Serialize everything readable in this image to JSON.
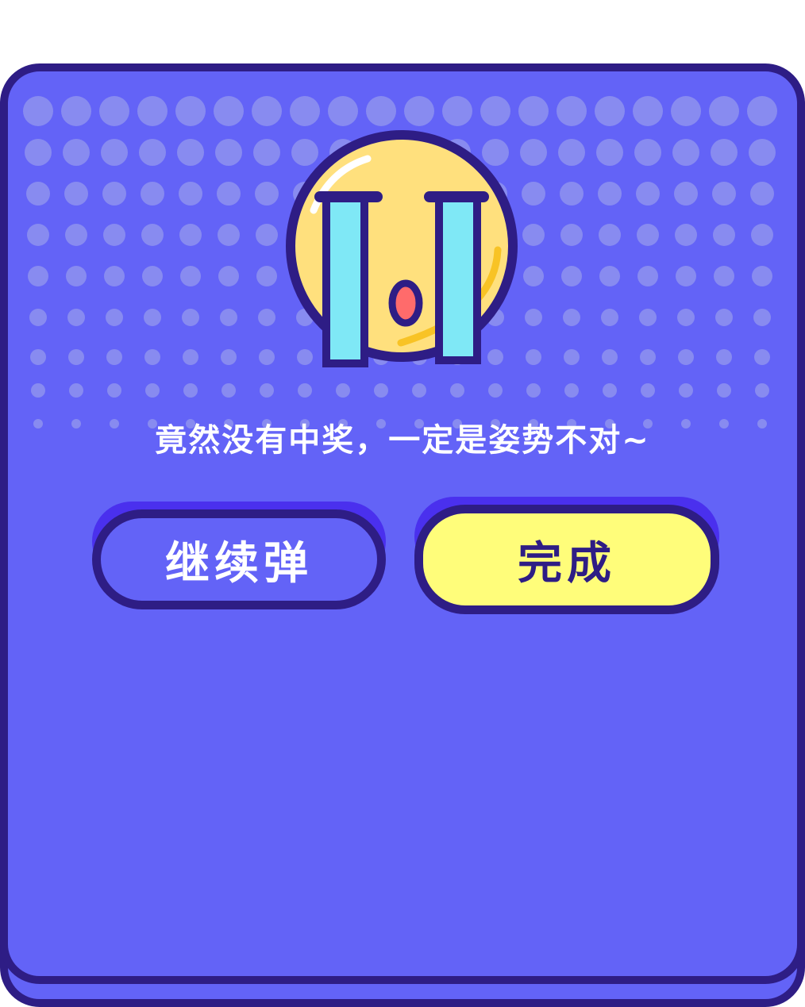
{
  "dialog": {
    "message": "竟然没有中奖，一定是姿势不对~",
    "continue_label": "继续弹",
    "done_label": "完成"
  },
  "colors": {
    "panel": "#6363f7",
    "border": "#2e1d85",
    "dots": "#8e92ef",
    "emoji_face": "#ffe07d",
    "tears": "#7fe8f6",
    "mouth": "#ff6b6b",
    "done_button": "#fffd7a",
    "button_shadow": "#4a30ee"
  },
  "icons": {
    "emoji": "crying-face-icon"
  }
}
